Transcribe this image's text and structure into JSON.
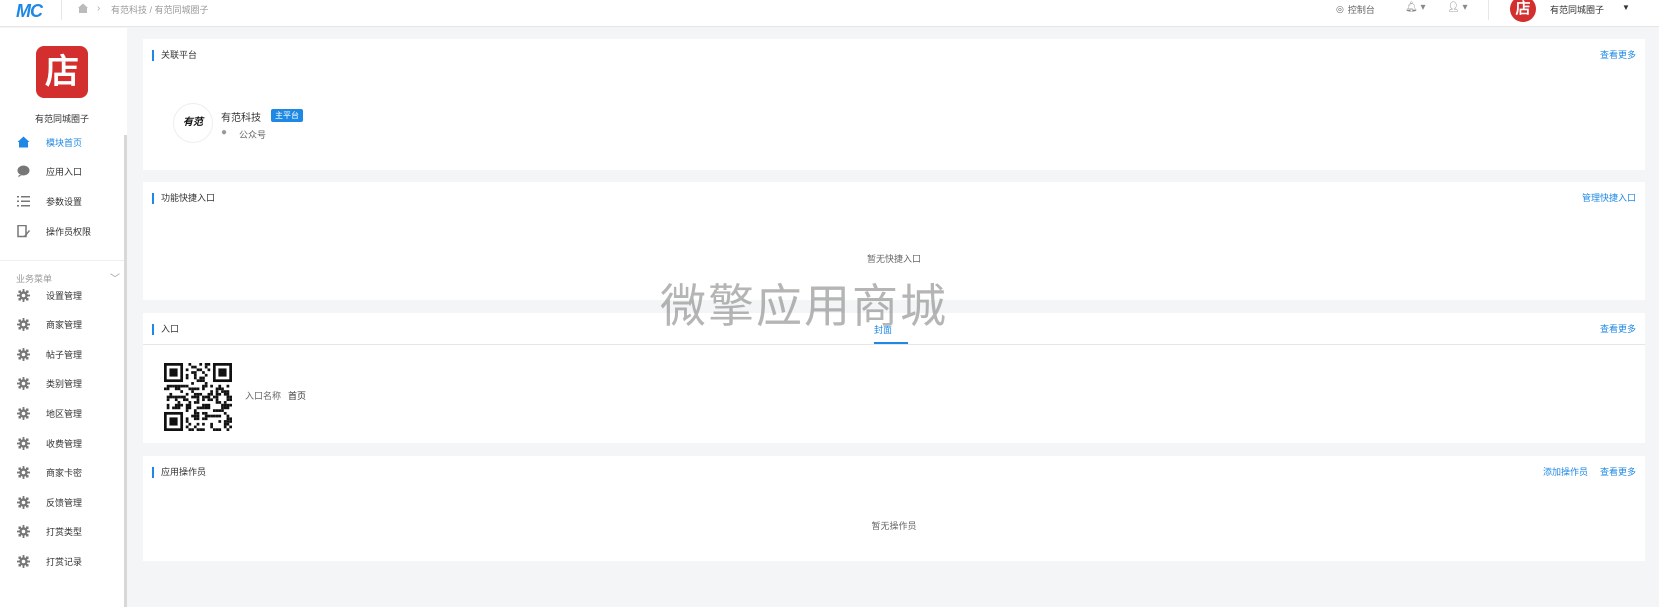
{
  "topbar": {
    "logo": "MC",
    "breadcrumb": "有范科技 / 有范同城圈子",
    "console_label": "控制台",
    "user_name": "有范同城圈子",
    "avatar_char": "店"
  },
  "sidebar": {
    "store_logo_char": "店",
    "store_name": "有范同城圈子",
    "items": [
      {
        "label": "模块首页",
        "icon": "home-icon"
      },
      {
        "label": "应用入口",
        "icon": "chat-icon"
      },
      {
        "label": "参数设置",
        "icon": "list-icon"
      },
      {
        "label": "操作员权限",
        "icon": "edit-icon"
      }
    ],
    "section_title": "业务菜单",
    "menu": [
      {
        "label": "设置管理",
        "icon": "gear-icon"
      },
      {
        "label": "商家管理",
        "icon": "gear-icon"
      },
      {
        "label": "帖子管理",
        "icon": "gear-icon"
      },
      {
        "label": "类别管理",
        "icon": "gear-icon"
      },
      {
        "label": "地区管理",
        "icon": "gear-icon"
      },
      {
        "label": "收费管理",
        "icon": "gear-icon"
      },
      {
        "label": "商家卡密",
        "icon": "gear-icon"
      },
      {
        "label": "反馈管理",
        "icon": "gear-icon"
      },
      {
        "label": "打赏类型",
        "icon": "gear-icon"
      },
      {
        "label": "打赏记录",
        "icon": "gear-icon"
      }
    ]
  },
  "platform": {
    "title": "关联平台",
    "more": "查看更多",
    "avatar_text": "有范",
    "name": "有范科技",
    "badge": "主平台",
    "type": "公众号"
  },
  "shortcuts": {
    "title": "功能快捷入口",
    "manage": "管理快捷入口",
    "empty": "暂无快捷入口"
  },
  "watermark": "微擎应用商城",
  "entry": {
    "title": "入口",
    "tab": "封面",
    "more": "查看更多",
    "label": "入口名称",
    "value": "首页"
  },
  "operators": {
    "title": "应用操作员",
    "add": "添加操作员",
    "more": "查看更多",
    "empty": "暂无操作员"
  },
  "colors": {
    "accent": "#1e88e5",
    "brand": "#d32f2f"
  }
}
